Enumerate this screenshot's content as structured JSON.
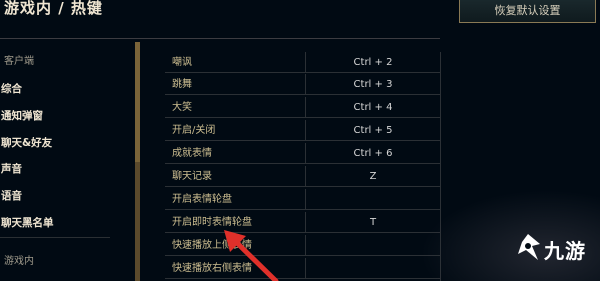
{
  "header": {
    "title": "游戏内 / 热键",
    "reset_button": "恢复默认设置"
  },
  "sidebar": {
    "section_client": "客户端",
    "items": [
      {
        "label": "综合"
      },
      {
        "label": "通知弹窗"
      },
      {
        "label": "聊天&好友"
      },
      {
        "label": "声音"
      },
      {
        "label": "语音"
      },
      {
        "label": "聊天黑名单"
      }
    ],
    "section_ingame": "游戏内"
  },
  "hotkeys": [
    {
      "name": "嘲讽",
      "key": "Ctrl + 2"
    },
    {
      "name": "跳舞",
      "key": "Ctrl + 3"
    },
    {
      "name": "大笑",
      "key": "Ctrl + 4"
    },
    {
      "name": "开启/关闭",
      "key": "Ctrl + 5"
    },
    {
      "name": "成就表情",
      "key": "Ctrl + 6"
    },
    {
      "name": "聊天记录",
      "key": "Z"
    },
    {
      "name": "开启表情轮盘",
      "key": ""
    },
    {
      "name": "开启即时表情轮盘",
      "key": "T"
    },
    {
      "name": "快速播放上侧表情",
      "key": ""
    },
    {
      "name": "快速播放右侧表情",
      "key": ""
    }
  ],
  "watermark": {
    "text": "九游",
    "icon": "jiuyou-logo-icon"
  },
  "annotation": {
    "icon": "red-arrow-icon",
    "color": "#e0302a"
  },
  "colors": {
    "background": "#010a13",
    "gold_text": "#cdbe91",
    "scrollbar": "#7a6439"
  }
}
